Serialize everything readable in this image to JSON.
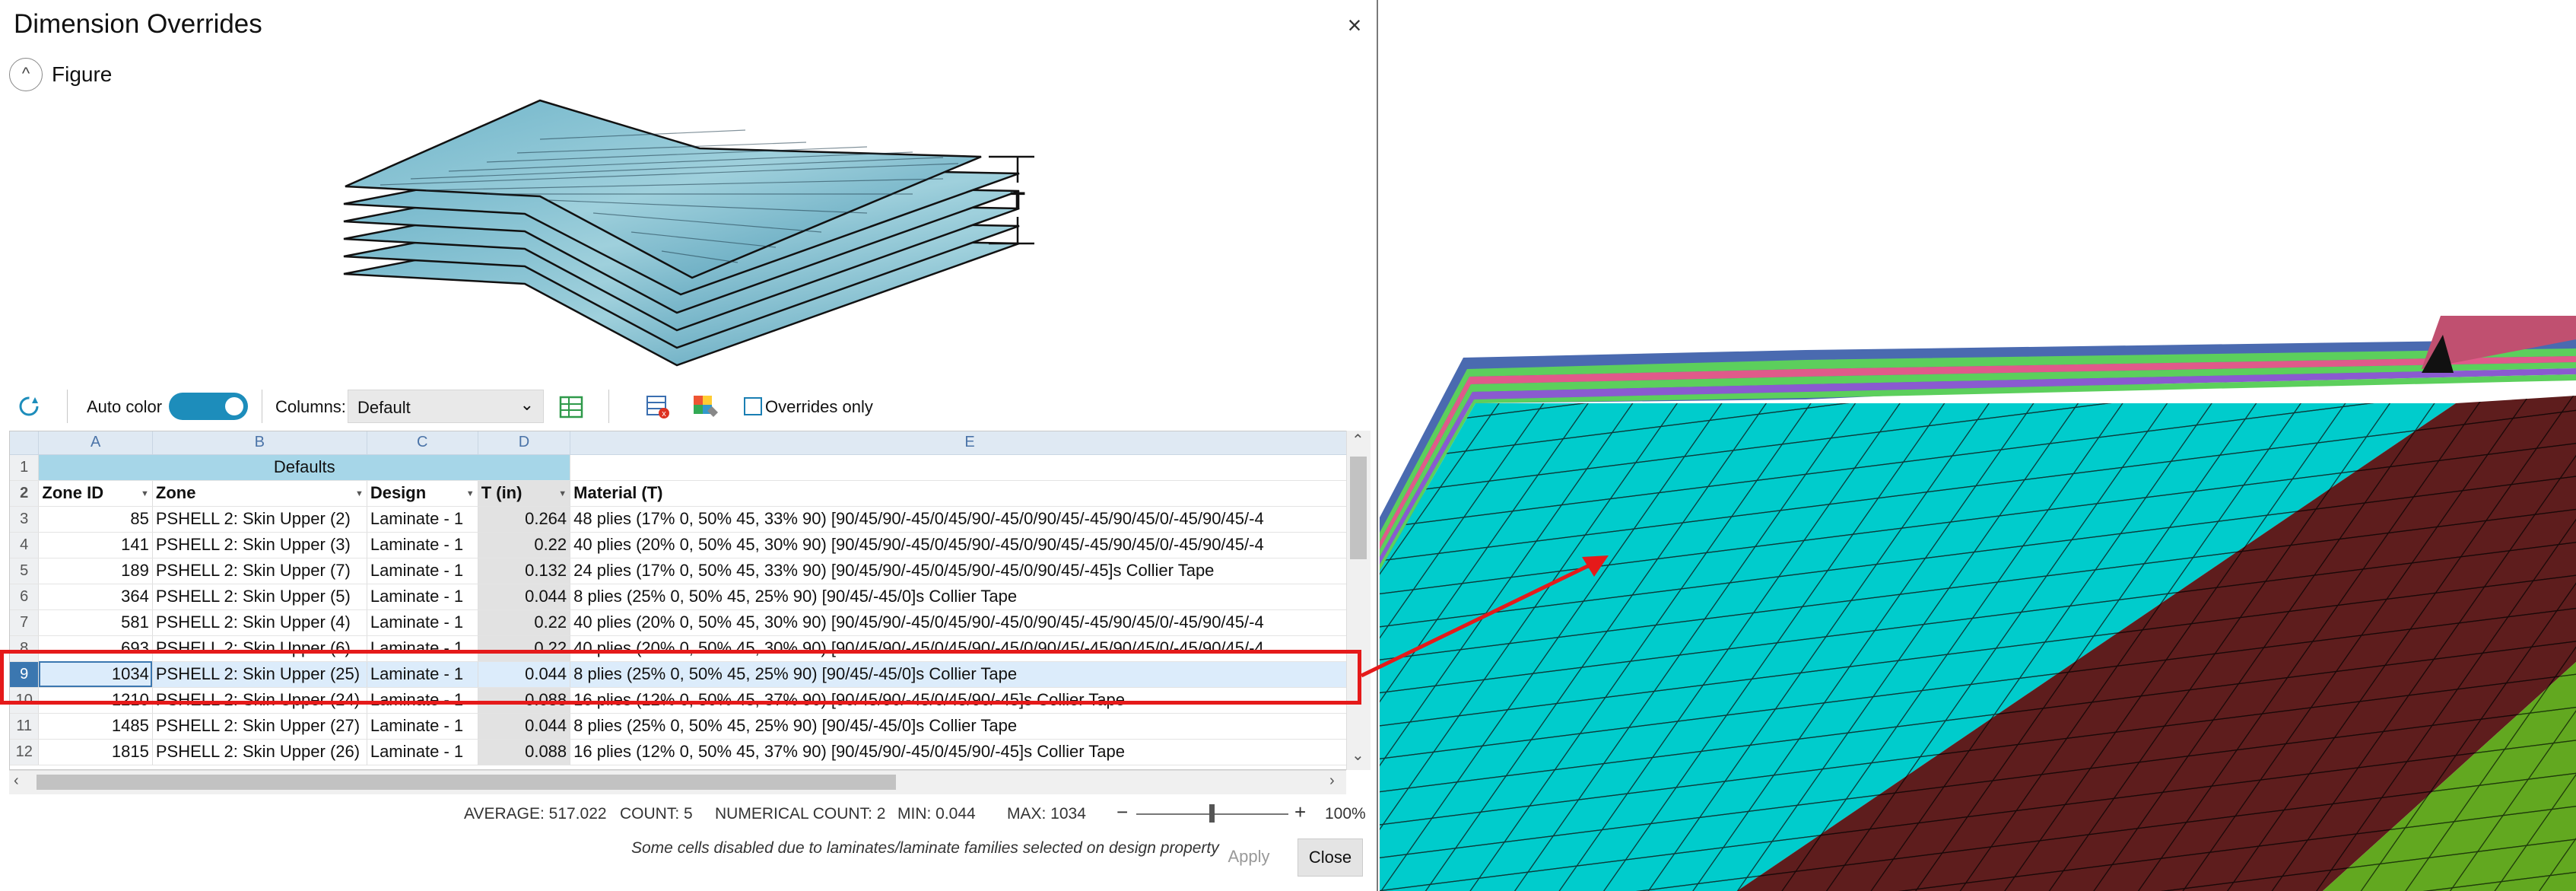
{
  "dialog": {
    "title": "Dimension Overrides",
    "close_icon": "×",
    "figure_label": "Figure",
    "figure_toggle_icon": "^",
    "figure_thickness_label": "T"
  },
  "toolbar": {
    "auto_color_label": "Auto color",
    "columns_label": "Columns:",
    "columns_value": "Default",
    "overrides_only_label": "Overrides only"
  },
  "grid": {
    "col_letters": [
      "A",
      "B",
      "C",
      "D",
      "E"
    ],
    "defaults_label": "Defaults",
    "headers": [
      "Zone ID",
      "Zone",
      "Design",
      "T (in)",
      "Material (T)"
    ],
    "rows": [
      {
        "rn": "3",
        "id": "85",
        "zone": "PSHELL 2: Skin Upper (2)",
        "design": "Laminate - 1",
        "t": "0.264",
        "mat": "48 plies (17% 0, 50% 45, 33% 90) [90/45/90/-45/0/45/90/-45/0/90/45/-45/90/45/0/-45/90/45/-4"
      },
      {
        "rn": "4",
        "id": "141",
        "zone": "PSHELL 2: Skin Upper (3)",
        "design": "Laminate - 1",
        "t": "0.22",
        "mat": "40 plies (20% 0, 50% 45, 30% 90) [90/45/90/-45/0/45/90/-45/0/90/45/-45/90/45/0/-45/90/45/-4"
      },
      {
        "rn": "5",
        "id": "189",
        "zone": "PSHELL 2: Skin Upper (7)",
        "design": "Laminate - 1",
        "t": "0.132",
        "mat": "24 plies (17% 0, 50% 45, 33% 90) [90/45/90/-45/0/45/90/-45/0/90/45/-45]s Collier Tape"
      },
      {
        "rn": "6",
        "id": "364",
        "zone": "PSHELL 2: Skin Upper (5)",
        "design": "Laminate - 1",
        "t": "0.044",
        "mat": "8 plies (25% 0, 50% 45, 25% 90) [90/45/-45/0]s Collier Tape"
      },
      {
        "rn": "7",
        "id": "581",
        "zone": "PSHELL 2: Skin Upper (4)",
        "design": "Laminate - 1",
        "t": "0.22",
        "mat": "40 plies (20% 0, 50% 45, 30% 90) [90/45/90/-45/0/45/90/-45/0/90/45/-45/90/45/0/-45/90/45/-4"
      },
      {
        "rn": "8",
        "id": "693",
        "zone": "PSHELL 2: Skin Upper (6)",
        "design": "Laminate - 1",
        "t": "0.22",
        "mat": "40 plies (20% 0, 50% 45, 30% 90) [90/45/90/-45/0/45/90/-45/0/90/45/-45/90/45/0/-45/90/45/-4"
      },
      {
        "rn": "9",
        "id": "1034",
        "zone": "PSHELL 2: Skin Upper (25)",
        "design": "Laminate - 1",
        "t": "0.044",
        "mat": "8 plies (25% 0, 50% 45, 25% 90) [90/45/-45/0]s Collier Tape"
      },
      {
        "rn": "10",
        "id": "1210",
        "zone": "PSHELL 2: Skin Upper (24)",
        "design": "Laminate - 1",
        "t": "0.088",
        "mat": "16 plies (12% 0, 50% 45, 37% 90) [90/45/90/-45/0/45/90/-45]s Collier Tape"
      },
      {
        "rn": "11",
        "id": "1485",
        "zone": "PSHELL 2: Skin Upper (27)",
        "design": "Laminate - 1",
        "t": "0.044",
        "mat": "8 plies (25% 0, 50% 45, 25% 90) [90/45/-45/0]s Collier Tape"
      },
      {
        "rn": "12",
        "id": "1815",
        "zone": "PSHELL 2: Skin Upper (26)",
        "design": "Laminate - 1",
        "t": "0.088",
        "mat": "16 plies (12% 0, 50% 45, 37% 90) [90/45/90/-45/0/45/90/-45]s Collier Tape"
      }
    ]
  },
  "status": {
    "average": "AVERAGE: 517.022",
    "count": "COUNT: 5",
    "numerical_count": "NUMERICAL COUNT: 2",
    "min": "MIN: 0.044",
    "max": "MAX: 1034",
    "zoom_minus": "−",
    "zoom_plus": "+",
    "zoom": "100%"
  },
  "footer": {
    "note": "Some cells disabled due to laminates/laminate families selected on design property",
    "apply_label": "Apply",
    "close_label": "Close"
  },
  "colors": {
    "accent": "#1d8dbb",
    "highlight": "#e51a1a",
    "mesh_cyan": "#00cccc",
    "mesh_maroon": "#5e1d1d",
    "mesh_green": "#62a820"
  }
}
